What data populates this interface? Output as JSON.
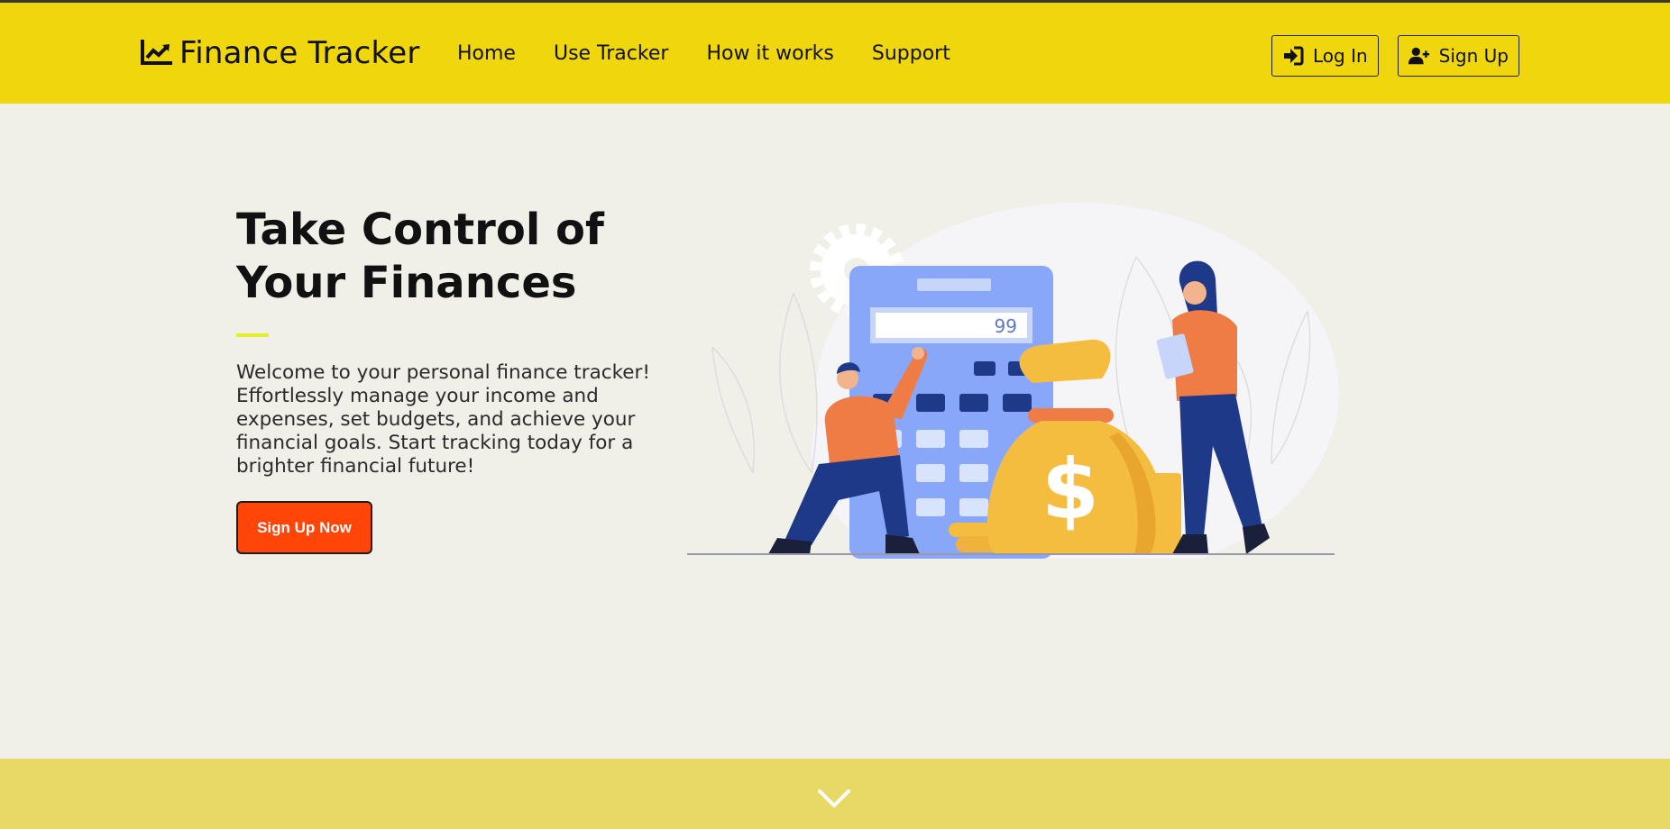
{
  "header": {
    "brand": "Finance Tracker",
    "brand_icon": "chart-line-icon",
    "nav": [
      "Home",
      "Use Tracker",
      "How it works",
      "Support"
    ],
    "login_label": "Log In",
    "login_icon": "sign-in-icon",
    "signup_label": "Sign Up",
    "signup_icon": "user-plus-icon"
  },
  "hero": {
    "title": "Take Control of Your Finances",
    "body": "Welcome to your personal finance tracker! Effortlessly manage your income and expenses, set budgets, and achieve your financial goals. Start tracking today for a brighter financial future!",
    "cta_label": "Sign Up Now"
  },
  "illustration": {
    "calculator_display": "99",
    "money_symbol": "$"
  },
  "footer": {
    "scroll_icon": "chevron-down-icon"
  },
  "colors": {
    "header_bg": "#efd60d",
    "page_bg": "#f0efe8",
    "cta_bg": "#ff4508",
    "accent_line": "#e3ee2f",
    "footer_band": "#e8d966",
    "calculator_blue": "#89a7f8",
    "money_yellow": "#f5bd3f",
    "shirt_orange": "#ef7b45",
    "pants_navy": "#1f3989"
  }
}
